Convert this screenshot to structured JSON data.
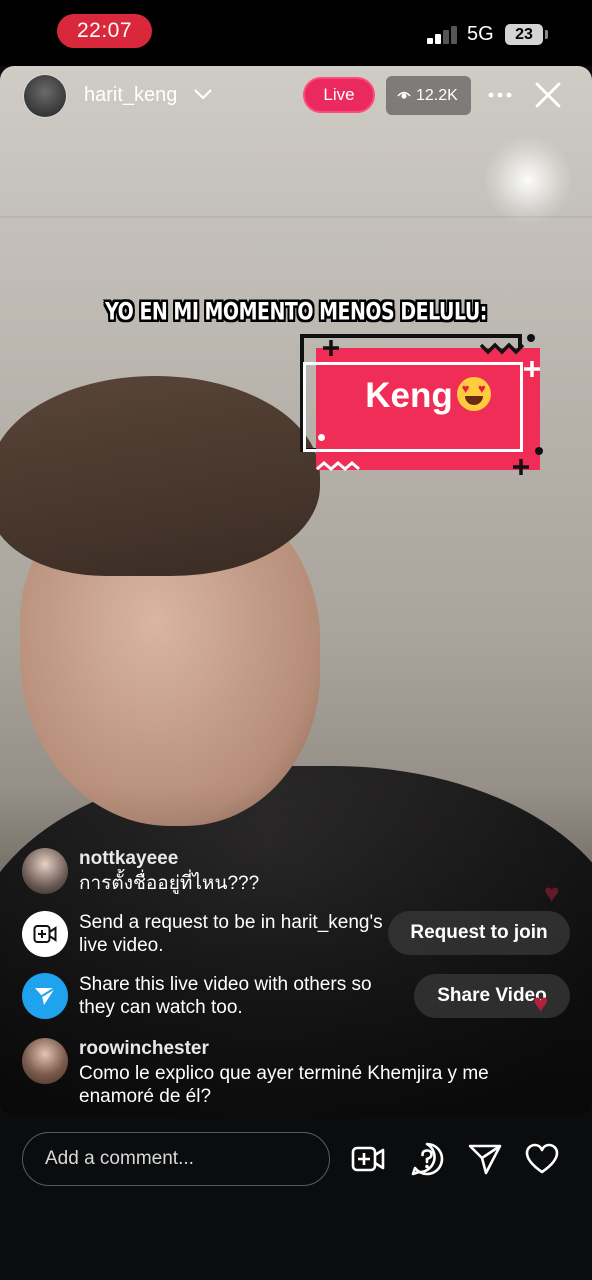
{
  "status_bar": {
    "time": "22:07",
    "network": "5G",
    "battery": "23"
  },
  "live": {
    "username": "harit_keng",
    "live_label": "Live",
    "viewer_count": "12.2K"
  },
  "meme": {
    "caption": "YO EN MI MOMENTO MENOS DELULU:",
    "sticker_text": "Keng"
  },
  "comments": [
    {
      "user": "nottkayeee",
      "text": "การตั้งชื่ออยู่ที่ไหน???"
    },
    {
      "user": "roowinchester",
      "text": "Como le explico que ayer terminé Khemjira y me enamoré de él?"
    }
  ],
  "system": {
    "request": {
      "text": "Send a request to be in harit_keng's live video.",
      "button": "Request to join"
    },
    "share": {
      "text": "Share this live video with others so they can watch too.",
      "button": "Share Video"
    }
  },
  "composer": {
    "placeholder": "Add a comment..."
  },
  "icons": [
    "eye-icon",
    "more-icon",
    "close-icon",
    "video-add-icon",
    "question-icon",
    "send-icon",
    "heart-icon",
    "chevron-down-icon"
  ]
}
